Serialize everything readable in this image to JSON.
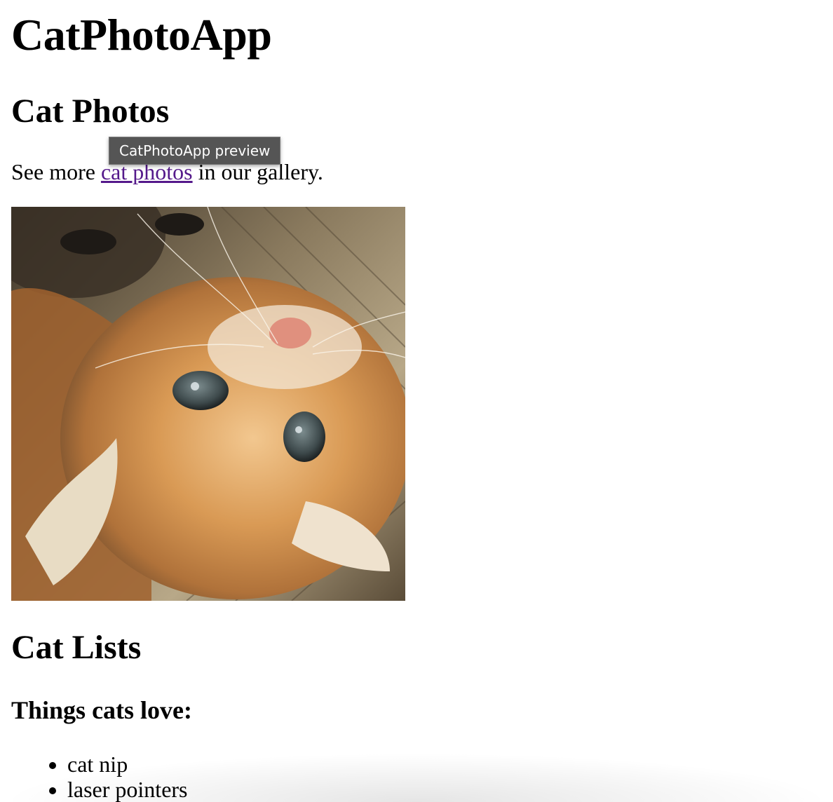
{
  "header": {
    "title": "CatPhotoApp"
  },
  "photos_section": {
    "heading": "Cat Photos",
    "text_before_link": "See more ",
    "link_text": "cat photos",
    "text_after_link": " in our gallery.",
    "image_alt": "A cute orange cat lying on its back."
  },
  "tooltip": {
    "text": "CatPhotoApp preview"
  },
  "lists_section": {
    "heading": "Cat Lists",
    "subheading": "Things cats love:",
    "items": [
      "cat nip",
      "laser pointers"
    ]
  },
  "colors": {
    "visited_link": "#551a8b",
    "tooltip_bg": "#555555"
  }
}
